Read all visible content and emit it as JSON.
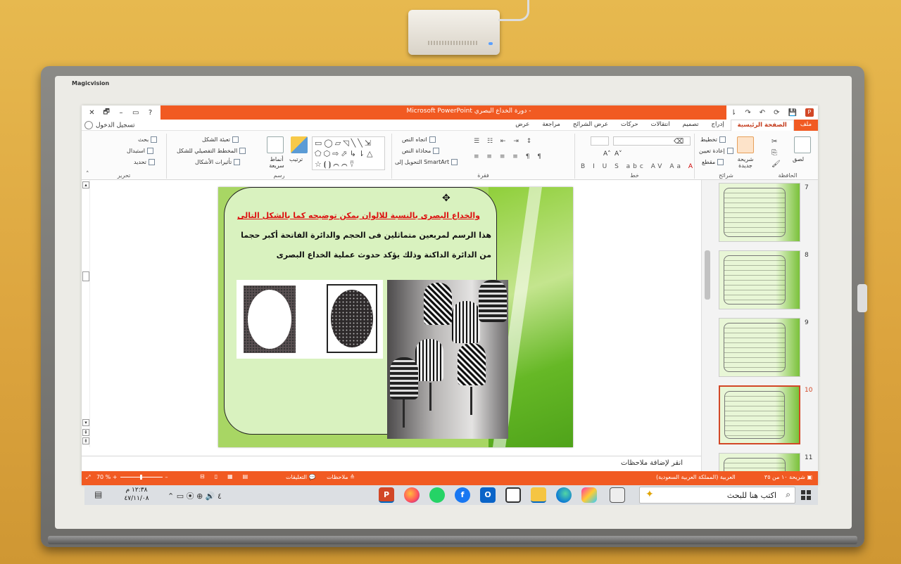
{
  "window": {
    "app_title": "Microsoft PowerPoint",
    "doc_title": "دورة الخداع البصري -",
    "controls": [
      "?",
      "▭",
      "–",
      "🗗",
      "✕"
    ],
    "qat": [
      "↶",
      "↷",
      "⟳",
      "💾"
    ]
  },
  "account": {
    "signin_label": "تسجيل الدخول"
  },
  "tabs": [
    {
      "label": "ملف",
      "state": "file"
    },
    {
      "label": "الصفحة الرئيسية",
      "state": "active"
    },
    {
      "label": "إدراج",
      "state": ""
    },
    {
      "label": "تصميم",
      "state": ""
    },
    {
      "label": "انتقالات",
      "state": ""
    },
    {
      "label": "حركات",
      "state": ""
    },
    {
      "label": "عرض الشرائح",
      "state": ""
    },
    {
      "label": "مراجعة",
      "state": ""
    },
    {
      "label": "عرض",
      "state": ""
    }
  ],
  "ribbon": {
    "clipboard": {
      "label": "الحافظة",
      "paste": "لصق"
    },
    "slides": {
      "label": "شرائح",
      "new_slide": "شريحة جديدة",
      "layout": "تخطيط",
      "reset": "إعادة تعيين",
      "section": "مقطع"
    },
    "font": {
      "label": "خط",
      "bold": "B",
      "italic": "I",
      "underline": "U",
      "shadow": "S",
      "strike": "abc",
      "spacing": "AV",
      "case": "Aa",
      "color": "A"
    },
    "paragraph": {
      "label": "فقرة",
      "text_direction": "اتجاه النص",
      "align_text": "محاذاة النص",
      "convert_smartart": "التحويل إلى SmartArt"
    },
    "drawing": {
      "label": "رسم",
      "arrange": "ترتيب",
      "quick_styles": "أنماط سريعة",
      "shape_fill": "تعبئة الشكل",
      "shape_outline": "المخطط التفصيلي للشكل",
      "shape_effects": "تأثيرات الأشكال",
      "shapes_glyphs": "▭◯▱◹╲╲⇲ ⬠⬡⇨⬀↳⇂△ ☆⦗⦘⌒⌒⍢"
    },
    "editing": {
      "label": "تحرير",
      "find": "بحث",
      "replace": "استبدال",
      "select": "تحديد"
    }
  },
  "slide": {
    "title": "والخداع البصرى بالنسبة للالوان  يمكن توضيحه كما بالشكل التالى",
    "line1": "هذا الرسم لمربعين متماثلين فى الحجم والدائرة الفاتحة أكبر حجما",
    "line2": "من الدائرة الداكنة وذلك يؤكد حدوث عملية الخداع البصرى"
  },
  "notes": {
    "placeholder": "انقر لإضافة ملاحظات"
  },
  "thumbnails": [
    {
      "num": "7",
      "selected": false
    },
    {
      "num": "8",
      "selected": false
    },
    {
      "num": "9",
      "selected": false
    },
    {
      "num": "10",
      "selected": true
    },
    {
      "num": "11",
      "selected": false
    }
  ],
  "statusbar": {
    "zoom": "70 %",
    "zoom_fraction": 0.5,
    "comments": "التعليقات",
    "notes": "ملاحظات",
    "language": "العربية (المملكة العربية السعودية)",
    "slide_position": "شريحة ١٠ من ٣٥"
  },
  "taskbar": {
    "search_placeholder": "اكتب هنا للبحث",
    "time": "١٢:٣٨ م",
    "date": "٤٧/١١/٠٨",
    "tray": "⌃ ▭ ⦿ ⊕ 🔊 ٤",
    "apps": [
      "powerpoint-icon",
      "firefox-icon",
      "whatsapp-icon",
      "facebook-icon",
      "outlook-icon",
      "store-icon",
      "file-explorer-icon",
      "edge-icon",
      "copilot-icon",
      "task-view-icon"
    ]
  },
  "board": {
    "brand": "Magicvision"
  }
}
